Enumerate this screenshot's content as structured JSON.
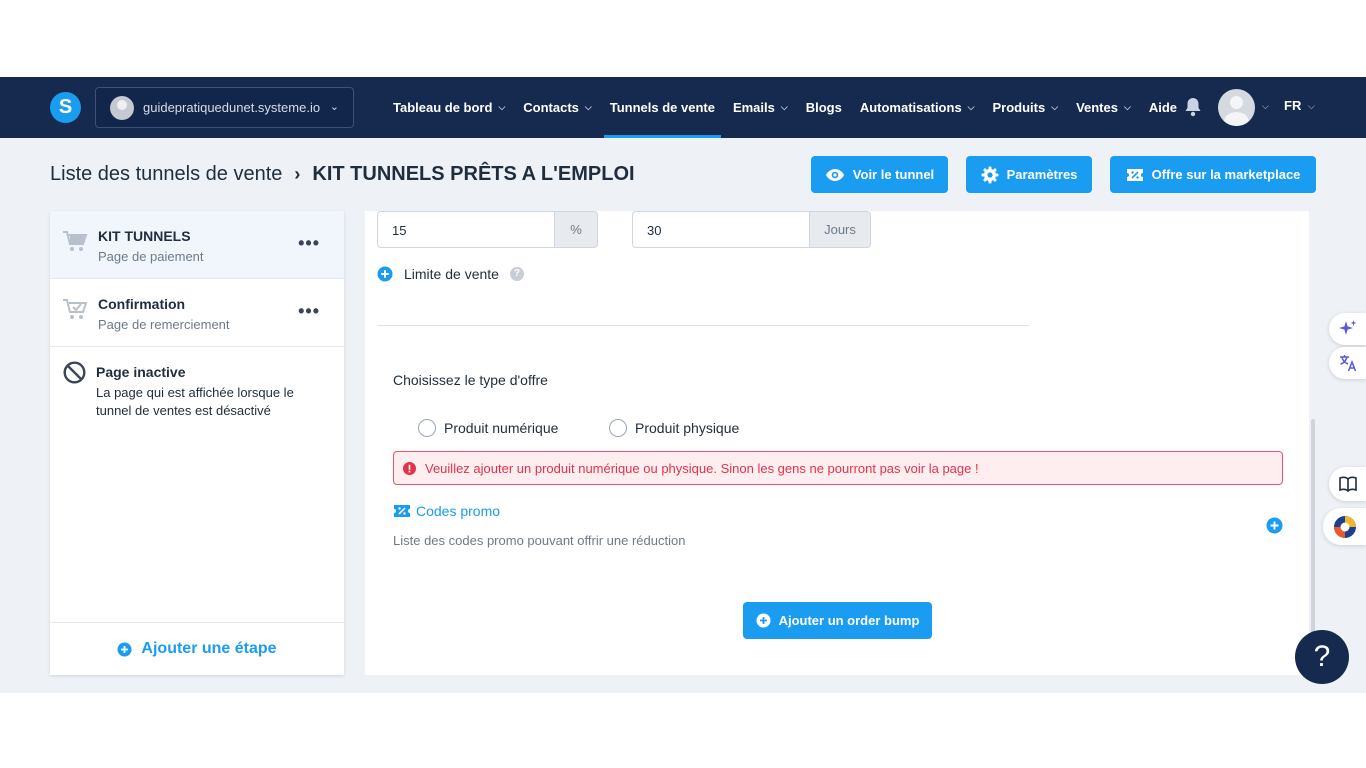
{
  "nav": {
    "logo_letter": "S",
    "site_name": "guidepratiquedunet.systeme.io",
    "items": [
      {
        "label": "Tableau de bord",
        "caret": true
      },
      {
        "label": "Contacts",
        "caret": true
      },
      {
        "label": "Tunnels de vente",
        "caret": false,
        "active": true
      },
      {
        "label": "Emails",
        "caret": true
      },
      {
        "label": "Blogs",
        "caret": false
      },
      {
        "label": "Automatisations",
        "caret": true
      },
      {
        "label": "Produits",
        "caret": true
      },
      {
        "label": "Ventes",
        "caret": true
      },
      {
        "label": "Aide",
        "caret": false
      }
    ],
    "language": "FR"
  },
  "header": {
    "breadcrumb_parent": "Liste des tunnels de vente",
    "breadcrumb_current": "KIT TUNNELS PRÊTS A L'EMPLOI",
    "view_button": "Voir le tunnel",
    "settings_button": "Paramètres",
    "marketplace_button": "Offre sur la marketplace"
  },
  "sidebar": {
    "steps": [
      {
        "title": "KIT TUNNELS",
        "subtitle": "Page de paiement",
        "selected": true
      },
      {
        "title": "Confirmation",
        "subtitle": "Page de remerciement",
        "selected": false
      }
    ],
    "inactive_title": "Page inactive",
    "inactive_desc": "La page qui est affichée lorsque le tunnel de ventes est désactivé",
    "add_step": "Ajouter une étape"
  },
  "main": {
    "discount_value": "15",
    "discount_unit": "%",
    "duration_value": "30",
    "duration_unit": "Jours",
    "sale_limit": "Limite de vente",
    "help_glyph": "?",
    "offer_type_label": "Choisissez le type d'offre",
    "offer_options": [
      "Produit numérique",
      "Produit physique"
    ],
    "alert_text": "Veuillez ajouter un produit numérique ou physique. Sinon les gens ne pourront pas voir la page !",
    "promo_title": "Codes promo",
    "promo_desc": "Liste des codes promo pouvant offrir une réduction",
    "order_bump_button": "Ajouter un order bump"
  },
  "floating": {
    "help_glyph": "?"
  },
  "colors": {
    "nav_bg": "#162a4f",
    "primary": "#1a9cf0",
    "danger": "#e0334a",
    "page_bg": "#eef2f7"
  }
}
